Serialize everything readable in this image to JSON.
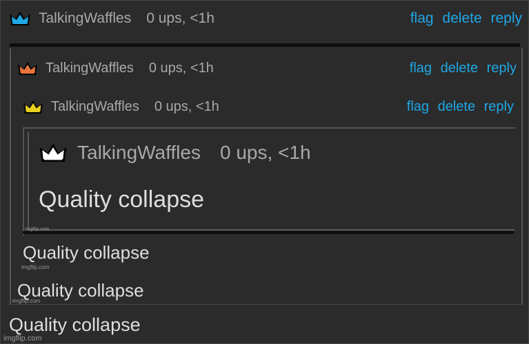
{
  "colors": {
    "background": "#2b2b2b",
    "link": "#1fa7e6",
    "text": "#dedede",
    "muted": "#a9a9a9"
  },
  "comments": [
    {
      "crown_color": "#1fa7e6",
      "crown_icon": "crown-icon",
      "username": "TalkingWaffles",
      "meta": "0 ups, <1h",
      "flag": "flag",
      "delete": "delete",
      "reply": "reply"
    },
    {
      "crown_color": "#e8743b",
      "crown_icon": "crown-icon",
      "username": "TalkingWaffles",
      "meta": "0 ups, <1h",
      "flag": "flag",
      "delete": "delete",
      "reply": "reply"
    },
    {
      "crown_color": "#e8d21f",
      "crown_icon": "crown-icon",
      "username": "TalkingWaffles",
      "meta": "0 ups, <1h",
      "flag": "flag",
      "delete": "delete",
      "reply": "reply"
    },
    {
      "crown_color": "#ffffff",
      "crown_icon": "crown-icon",
      "username": "TalkingWaffles",
      "meta": "0 ups, <1h"
    }
  ],
  "bodies": [
    "Quality collapse",
    "Quality collapse",
    "Quality collapse",
    "Quality collapse"
  ],
  "watermarks": [
    "imgflip.com",
    "imgflip.com",
    "imgflip.com",
    "imgflip.com"
  ]
}
